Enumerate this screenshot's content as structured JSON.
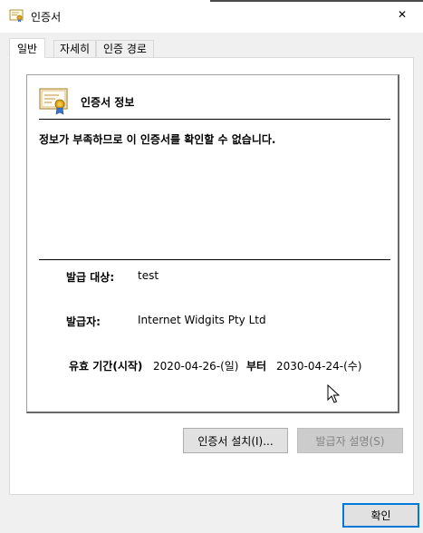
{
  "window": {
    "title": "인증서",
    "close_glyph": "✕"
  },
  "tabs": [
    {
      "label": "일반",
      "active": true
    },
    {
      "label": "자세히",
      "active": false
    },
    {
      "label": "인증 경로",
      "active": false
    }
  ],
  "info": {
    "heading": "인증서 정보",
    "warning": "정보가 부족하므로 이 인증서를 확인할 수 없습니다.",
    "issued_to_label": "발급 대상:",
    "issued_to_value": "test",
    "issued_by_label": "발급자:",
    "issued_by_value": "Internet Widgits Pty Ltd",
    "valid_label": "유효 기간(시작)",
    "valid_from": "2020-04-26-(일)",
    "valid_to_label": "부터",
    "valid_to": "2030-04-24-(수)"
  },
  "buttons": {
    "install": "인증서 설치(I)...",
    "issuer_statement": "발급자 설명(S)",
    "ok": "확인"
  },
  "icons": {
    "title": "certificate-icon",
    "info": "certificate-icon",
    "close": "close-icon",
    "cursor": "mouse-pointer-icon"
  }
}
